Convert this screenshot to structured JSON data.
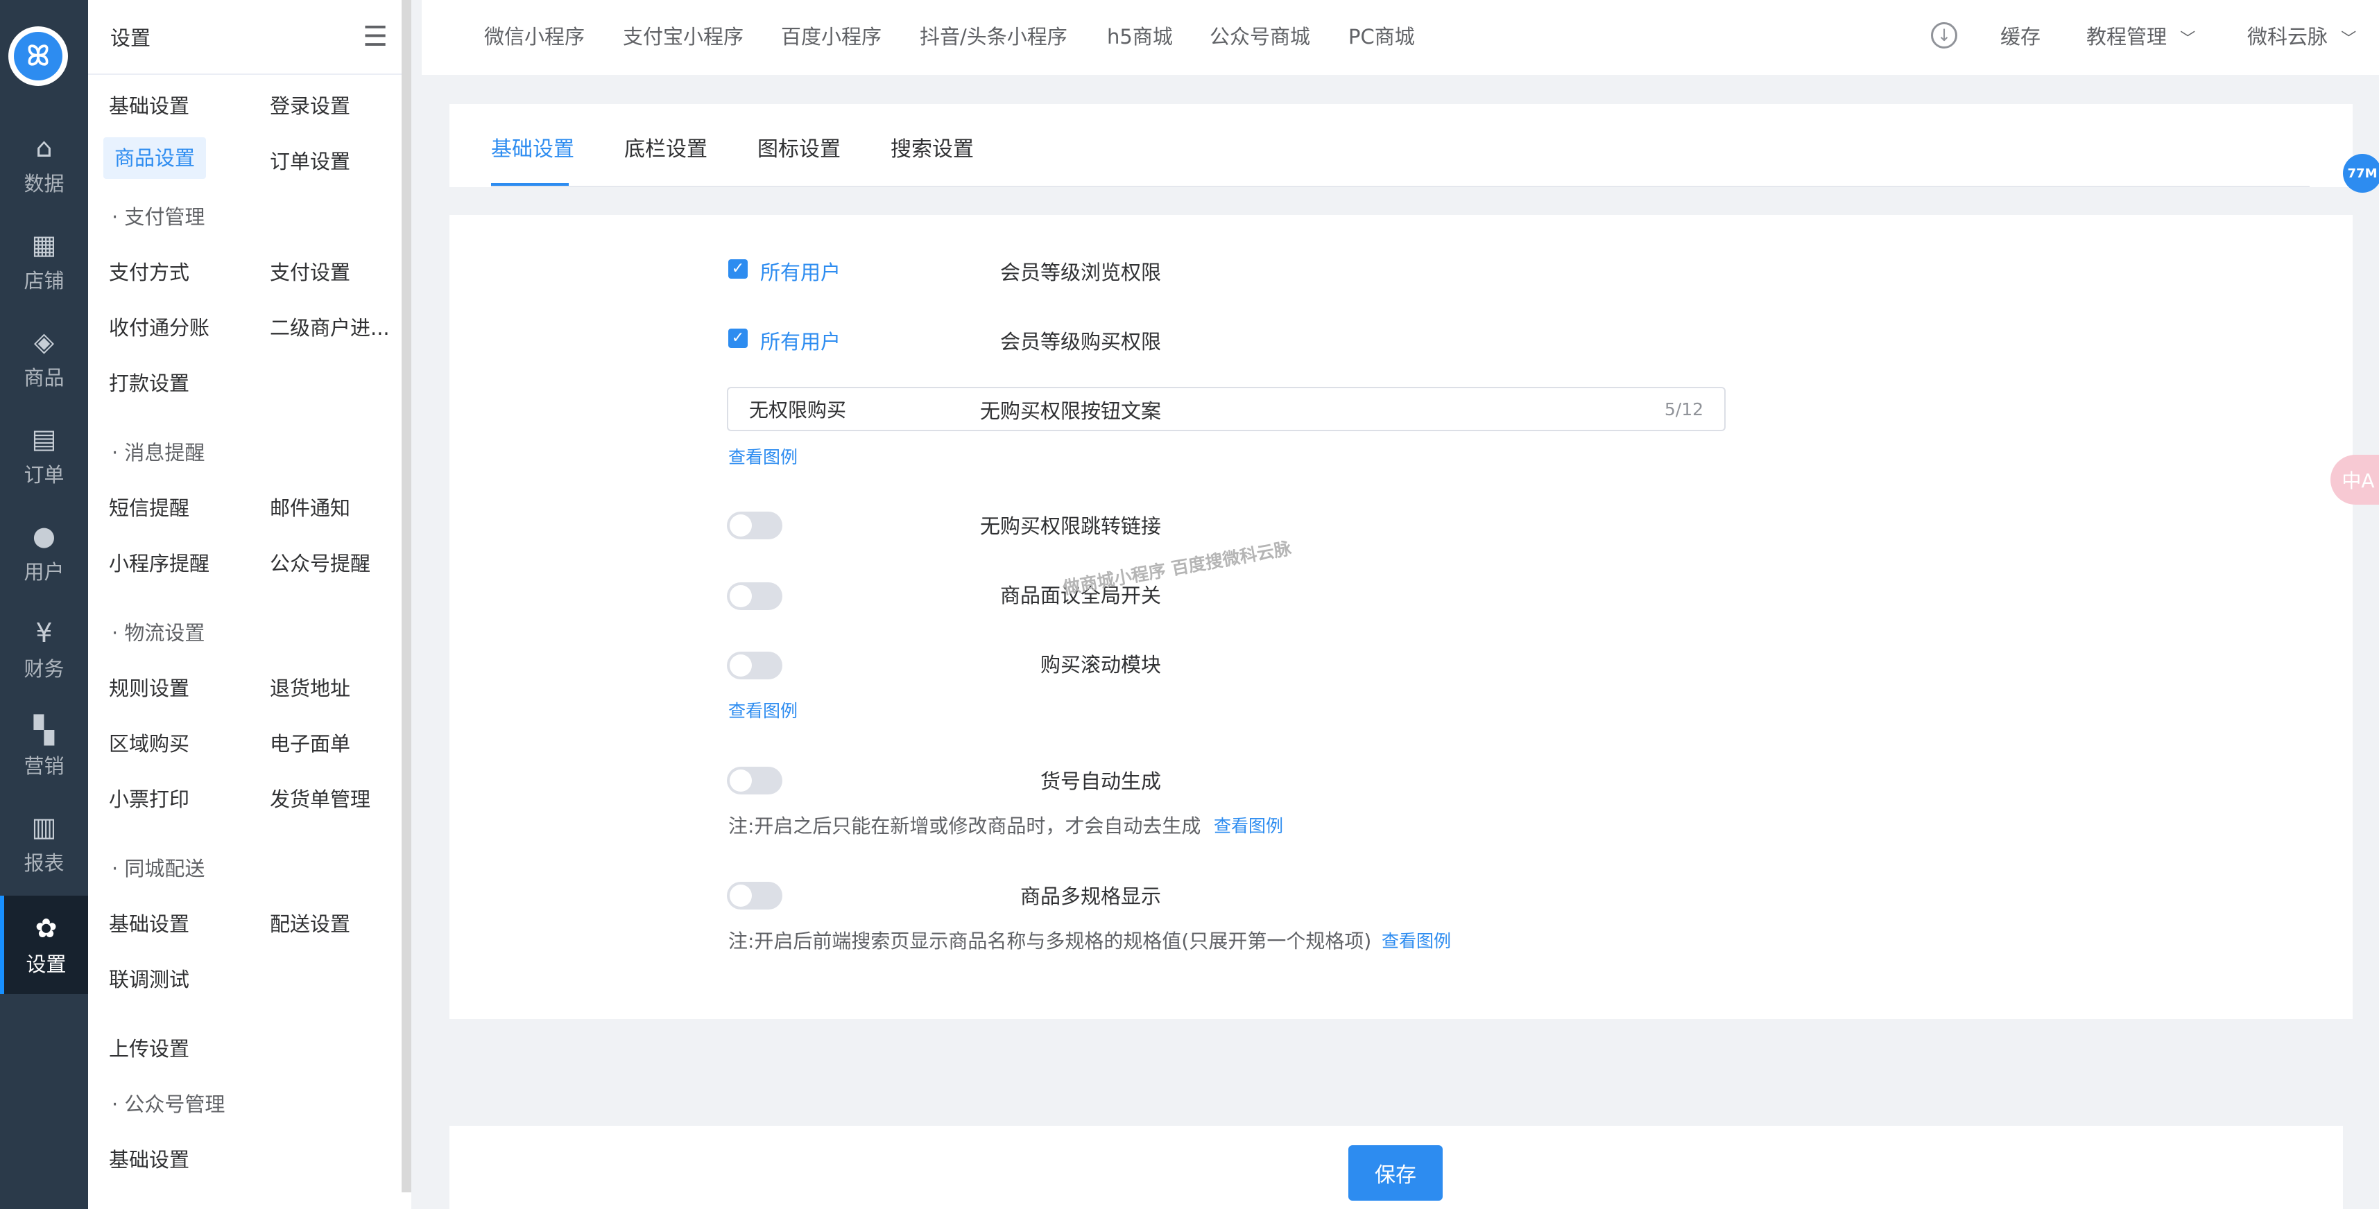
{
  "logo": {
    "glyph": "ꕤ"
  },
  "rail": [
    {
      "label": "数据",
      "icon": "home-icon",
      "glyph": "⌂"
    },
    {
      "label": "店铺",
      "icon": "shop-icon",
      "glyph": "▦"
    },
    {
      "label": "商品",
      "icon": "bag-icon",
      "glyph": "◈"
    },
    {
      "label": "订单",
      "icon": "order-icon",
      "glyph": "▤"
    },
    {
      "label": "用户",
      "icon": "user-icon",
      "glyph": "●"
    },
    {
      "label": "财务",
      "icon": "finance-icon",
      "glyph": "¥"
    },
    {
      "label": "营销",
      "icon": "marketing-icon",
      "glyph": "▚"
    },
    {
      "label": "报表",
      "icon": "report-icon",
      "glyph": "▥"
    },
    {
      "label": "设置",
      "icon": "gear-icon",
      "glyph": "✿"
    }
  ],
  "submenu": {
    "title": "设置",
    "menu_icon": "☰",
    "row1": [
      "基础设置",
      "登录设置"
    ],
    "row2": [
      "商品设置",
      "订单设置"
    ],
    "group_pay": "· 支付管理",
    "pay1": [
      "支付方式",
      "支付设置"
    ],
    "pay2": [
      "收付通分账",
      "二级商户进..."
    ],
    "pay3": "打款设置",
    "group_msg": "· 消息提醒",
    "msg1": [
      "短信提醒",
      "邮件通知"
    ],
    "msg2": [
      "小程序提醒",
      "公众号提醒"
    ],
    "group_logistics": "· 物流设置",
    "log1": [
      "规则设置",
      "退货地址"
    ],
    "log2": [
      "区域购买",
      "电子面单"
    ],
    "log3": [
      "小票打印",
      "发货单管理"
    ],
    "group_city": "· 同城配送",
    "city1": [
      "基础设置",
      "配送设置"
    ],
    "city2": "联调测试",
    "upload": "上传设置",
    "group_mp": "· 公众号管理",
    "mp1": "基础设置"
  },
  "topbar": {
    "tabs": [
      "微信小程序",
      "支付宝小程序",
      "百度小程序",
      "抖音/头条小程序",
      "h5商城",
      "公众号商城",
      "PC商城"
    ],
    "download_glyph": "↓",
    "cache": "缓存",
    "tutorial": "教程管理",
    "user": "微科云脉",
    "chevron": "﹀"
  },
  "tabs": [
    "基础设置",
    "底栏设置",
    "图标设置",
    "搜索设置"
  ],
  "form": {
    "view_perm_label": "会员等级浏览权限",
    "view_perm_value": "所有用户",
    "buy_perm_label": "会员等级购买权限",
    "buy_perm_value": "所有用户",
    "no_buy_text_label": "无购买权限按钮文案",
    "no_buy_text_value": "无权限购买",
    "no_buy_text_count": "5/12",
    "example_link": "查看图例",
    "no_buy_link_label": "无购买权限跳转链接",
    "negotiate_label": "商品面议全局开关",
    "scroll_label": "购买滚动模块",
    "sku_auto_label": "货号自动生成",
    "sku_auto_note": "注:开启之后只能在新增或修改商品时，才会自动去生成",
    "multi_spec_label": "商品多规格显示",
    "multi_spec_note": "注:开启后前端搜索页显示商品名称与多规格的规格值(只展开第一个规格项)",
    "checkmark": "✓"
  },
  "watermark": "做商城小程序 百度搜微科云脉",
  "save_label": "保存",
  "floating": {
    "memory": "77M",
    "translate": "中A"
  }
}
